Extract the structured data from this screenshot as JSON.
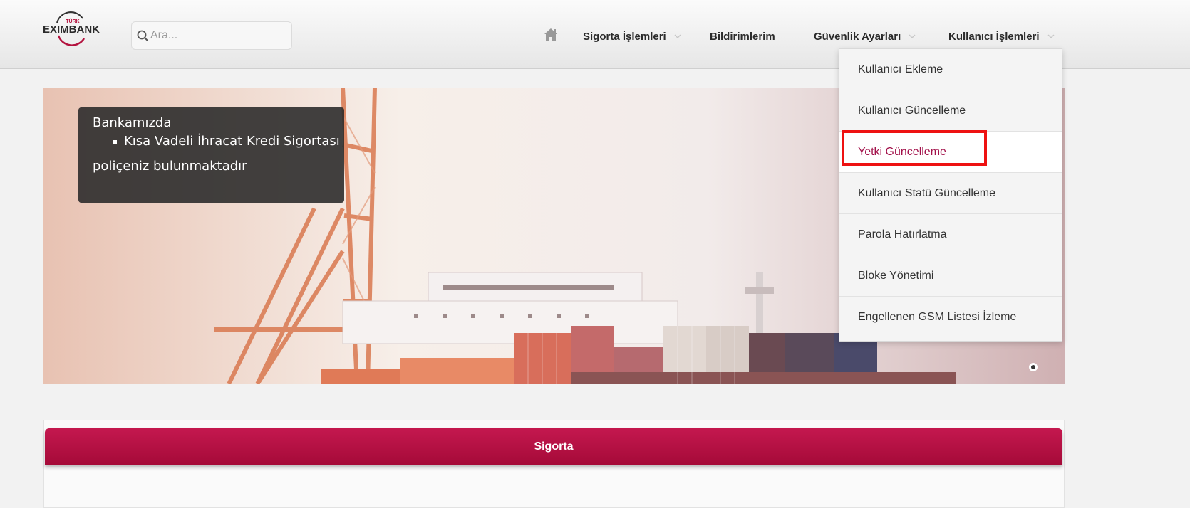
{
  "header": {
    "logo": {
      "small_text": "TÜRK",
      "main_text": "EXIMBANK"
    },
    "search": {
      "placeholder": "Ara..."
    },
    "nav": {
      "home_icon": "home-icon",
      "items": [
        {
          "label": "Sigorta İşlemleri",
          "has_dropdown": true
        },
        {
          "label": "Bildirimlerim",
          "has_dropdown": false
        },
        {
          "label": "Güvenlik Ayarları",
          "has_dropdown": true
        },
        {
          "label": "Kullanıcı İşlemleri",
          "has_dropdown": true,
          "open": true
        }
      ]
    }
  },
  "dropdown": {
    "items": [
      {
        "label": "Kullanıcı Ekleme"
      },
      {
        "label": "Kullanıcı Güncelleme"
      },
      {
        "label": "Yetki Güncelleme",
        "active": true,
        "highlighted": true
      },
      {
        "label": "Kullanıcı Statü Güncelleme"
      },
      {
        "label": "Parola Hatırlatma"
      },
      {
        "label": "Bloke Yönetimi"
      },
      {
        "label": "Engellenen GSM Listesi İzleme"
      }
    ],
    "highlight_color": "#ee1111"
  },
  "banner": {
    "info": {
      "line1": "Bankamızda",
      "bullet": "Kısa Vadeli İhracat Kredi Sigortası",
      "line3": "poliçeniz bulunmaktadır"
    },
    "slides": 1,
    "active_slide": 1
  },
  "panel": {
    "title": "Sigorta"
  },
  "colors": {
    "brand": "#a50a38",
    "active_menu_text": "#a2114a",
    "header_bg": "#ececec"
  }
}
